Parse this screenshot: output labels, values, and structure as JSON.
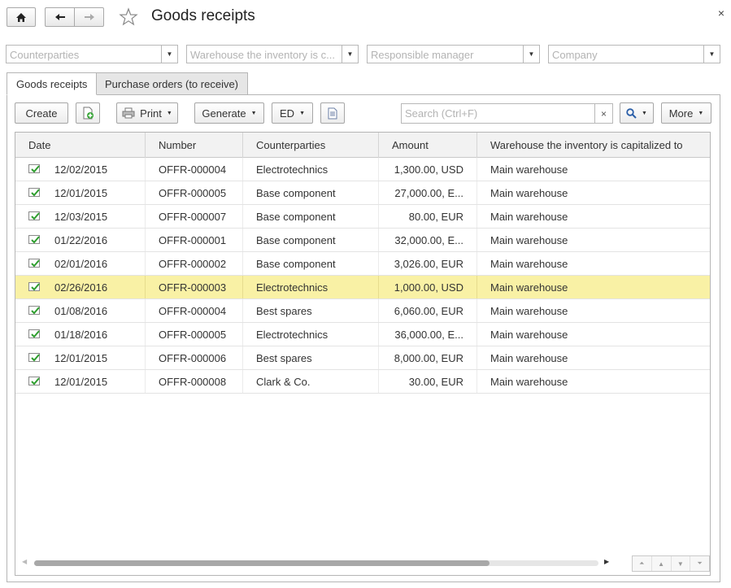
{
  "window": {
    "title": "Goods receipts",
    "close_glyph": "×"
  },
  "filters": [
    {
      "placeholder": "Counterparties"
    },
    {
      "placeholder": "Warehouse the inventory is c..."
    },
    {
      "placeholder": "Responsible manager"
    },
    {
      "placeholder": "Company"
    }
  ],
  "tabs": [
    {
      "label": "Goods receipts",
      "active": true
    },
    {
      "label": "Purchase orders (to receive)",
      "active": false
    }
  ],
  "toolbar": {
    "create_label": "Create",
    "print_label": "Print",
    "generate_label": "Generate",
    "ed_label": "ED",
    "search_placeholder": "Search (Ctrl+F)",
    "search_clear_glyph": "×",
    "more_label": "More"
  },
  "table": {
    "columns": [
      "Date",
      "Number",
      "Counterparties",
      "Amount",
      "Warehouse the inventory is capitalized to"
    ],
    "rows": [
      {
        "date": "12/02/2015",
        "number": "OFFR-000004",
        "counterparty": "Electrotechnics",
        "amount": "1,300.00, USD",
        "warehouse": "Main warehouse",
        "selected": false
      },
      {
        "date": "12/01/2015",
        "number": "OFFR-000005",
        "counterparty": "Base component",
        "amount": "27,000.00, E...",
        "warehouse": "Main warehouse",
        "selected": false
      },
      {
        "date": "12/03/2015",
        "number": "OFFR-000007",
        "counterparty": "Base component",
        "amount": "80.00, EUR",
        "warehouse": "Main warehouse",
        "selected": false
      },
      {
        "date": "01/22/2016",
        "number": "OFFR-000001",
        "counterparty": "Base component",
        "amount": "32,000.00, E...",
        "warehouse": "Main warehouse",
        "selected": false
      },
      {
        "date": "02/01/2016",
        "number": "OFFR-000002",
        "counterparty": "Base component",
        "amount": "3,026.00, EUR",
        "warehouse": "Main warehouse",
        "selected": false
      },
      {
        "date": "02/26/2016",
        "number": "OFFR-000003",
        "counterparty": "Electrotechnics",
        "amount": "1,000.00, USD",
        "warehouse": "Main warehouse",
        "selected": true
      },
      {
        "date": "01/08/2016",
        "number": "OFFR-000004",
        "counterparty": "Best spares",
        "amount": "6,060.00, EUR",
        "warehouse": "Main warehouse",
        "selected": false
      },
      {
        "date": "01/18/2016",
        "number": "OFFR-000005",
        "counterparty": "Electrotechnics",
        "amount": "36,000.00, E...",
        "warehouse": "Main warehouse",
        "selected": false
      },
      {
        "date": "12/01/2015",
        "number": "OFFR-000006",
        "counterparty": "Best spares",
        "amount": "8,000.00, EUR",
        "warehouse": "Main warehouse",
        "selected": false
      },
      {
        "date": "12/01/2015",
        "number": "OFFR-000008",
        "counterparty": "Clark & Co.",
        "amount": "30.00, EUR",
        "warehouse": "Main warehouse",
        "selected": false
      }
    ]
  },
  "colors": {
    "selected_row": "#f9f1a5",
    "doc_icon_check": "#2e9e2e"
  },
  "icons": [
    "home-icon",
    "back-arrow-icon",
    "forward-arrow-icon",
    "star-icon",
    "close-icon",
    "dropdown-arrow-icon",
    "add-document-icon",
    "printer-icon",
    "document-list-icon",
    "search-icon",
    "posted-document-icon",
    "scroll-first-icon",
    "scroll-up-icon",
    "scroll-down-icon",
    "scroll-last-icon"
  ]
}
